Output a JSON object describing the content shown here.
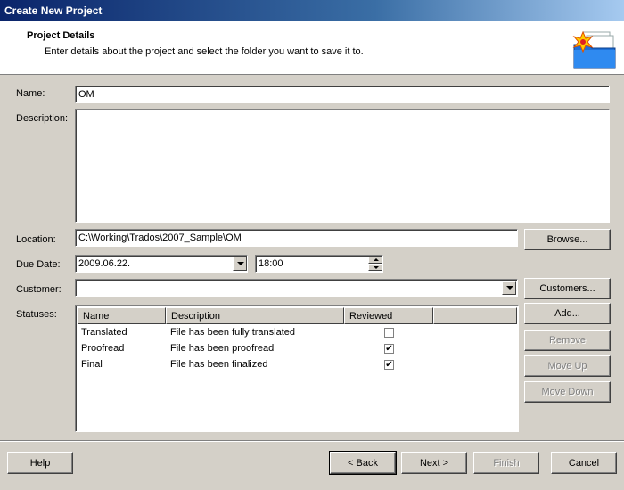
{
  "window": {
    "title": "Create New Project"
  },
  "header": {
    "title": "Project Details",
    "subtitle": "Enter details about the project and select the folder you want to save it to."
  },
  "form": {
    "name_label": "Name:",
    "name_value": "OM",
    "description_label": "Description:",
    "description_value": "",
    "location_label": "Location:",
    "location_value": "C:\\Working\\Trados\\2007_Sample\\OM",
    "browse_label": "Browse...",
    "due_date_label": "Due Date:",
    "due_date_value": "2009.06.22.",
    "due_time_value": "18:00",
    "customer_label": "Customer:",
    "customer_value": "",
    "customers_button": "Customers...",
    "statuses_label": "Statuses:"
  },
  "statuses": {
    "columns": [
      "Name",
      "Description",
      "Reviewed",
      ""
    ],
    "rows": [
      {
        "name": "Translated",
        "description": "File has been fully translated",
        "reviewed": false
      },
      {
        "name": "Proofread",
        "description": "File has been proofread",
        "reviewed": true
      },
      {
        "name": "Final",
        "description": "File has been finalized",
        "reviewed": true
      }
    ],
    "buttons": {
      "add": "Add...",
      "remove": "Remove",
      "move_up": "Move Up",
      "move_down": "Move Down"
    }
  },
  "footer": {
    "help": "Help",
    "back": "< Back",
    "next": "Next >",
    "finish": "Finish",
    "cancel": "Cancel"
  },
  "colors": {
    "titlebar_start": "#0a246a",
    "titlebar_end": "#a6caf0",
    "dialog_bg": "#d4d0c8",
    "disabled_text": "#808080"
  },
  "icons": {
    "header": "new-project-folder-icon",
    "checked": "✔"
  }
}
